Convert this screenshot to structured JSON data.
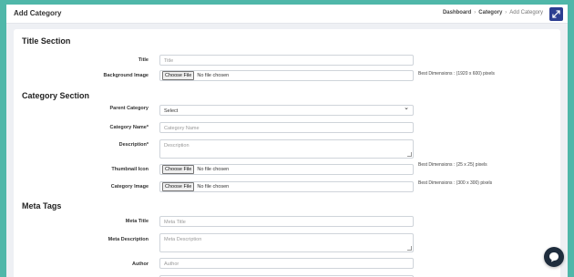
{
  "header": {
    "title": "Add Category",
    "breadcrumb": [
      "Dashboard",
      "Category",
      "Add Category"
    ],
    "breadcrumb_sep": "›",
    "expand_icon": "expand-icon"
  },
  "title_section": {
    "heading": "Title Section",
    "title_label": "Title",
    "title_placeholder": "Title",
    "bg_label": "Background Image",
    "bg_button": "Choose File",
    "bg_status": "No file chosen",
    "bg_hint": "Best Dimensions : (1920 x 600) pixels"
  },
  "category_section": {
    "heading": "Category Section",
    "parent_label": "Parent Category",
    "parent_value": "Select",
    "name_label": "Category Name*",
    "name_placeholder": "Category Name",
    "desc_label": "Description*",
    "desc_placeholder": "Description",
    "thumb_label": "Thumbnail Icon",
    "thumb_button": "Choose File",
    "thumb_status": "No file chosen",
    "thumb_hint": "Best Dimensions : (25 x 25) pixels",
    "image_label": "Category Image",
    "image_button": "Choose File",
    "image_status": "No file chosen",
    "image_hint": "Best Dimensions : (300 x 300) pixels"
  },
  "meta_section": {
    "heading": "Meta Tags",
    "meta_title_label": "Meta Title",
    "meta_title_placeholder": "Meta Title",
    "meta_desc_label": "Meta Description",
    "meta_desc_placeholder": "Meta Description",
    "author_label": "Author",
    "author_placeholder": "Author"
  },
  "colors": {
    "frame": "#4fb7a9",
    "accent": "#2c3e91",
    "chat": "#1f2d3d"
  }
}
